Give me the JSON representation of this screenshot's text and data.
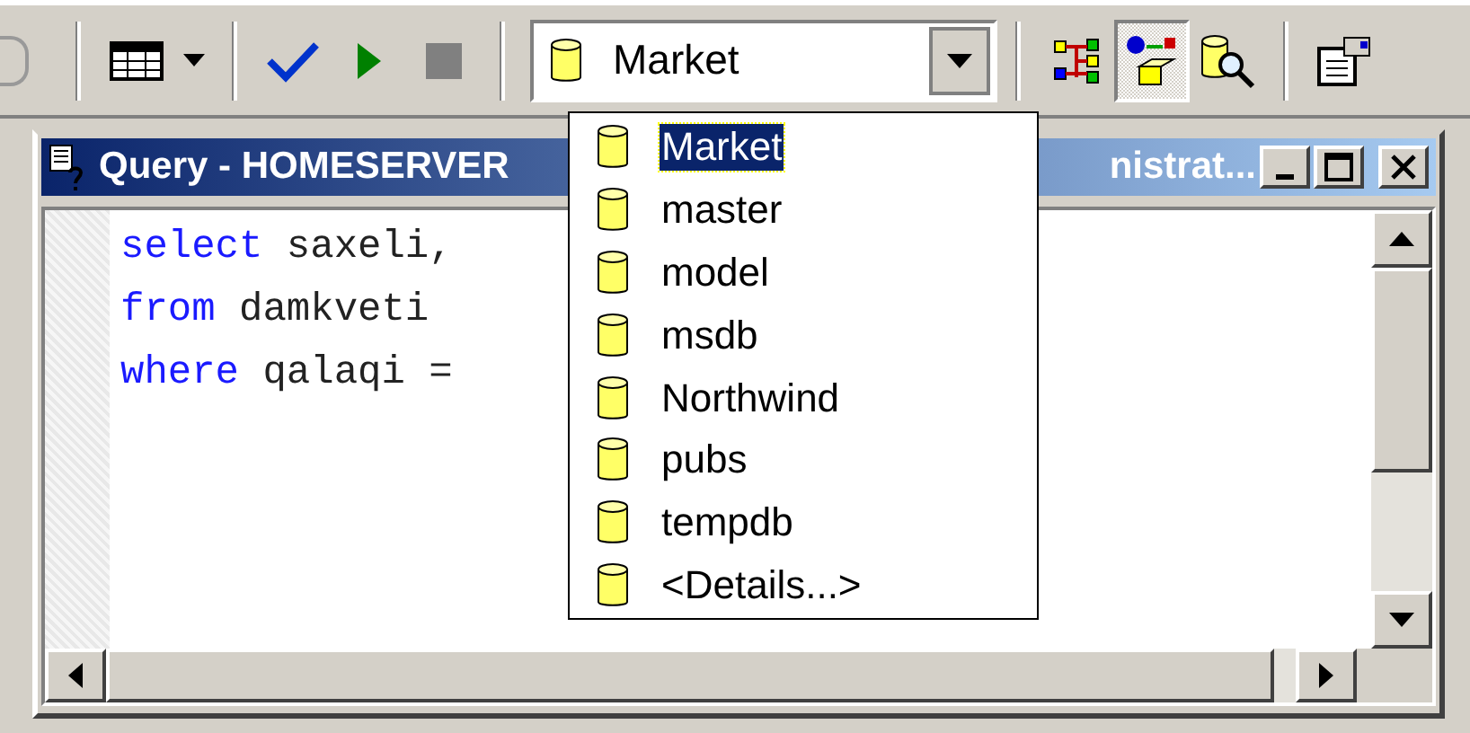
{
  "toolbar": {
    "buttons": [
      {
        "kind": "grid",
        "pressed": false
      },
      {
        "kind": "caret",
        "pressed": false
      },
      {
        "kind": "check",
        "pressed": false
      },
      {
        "kind": "play",
        "pressed": false
      },
      {
        "kind": "stop",
        "pressed": false
      },
      {
        "kind": "connections",
        "pressed": false
      },
      {
        "kind": "diagram",
        "pressed": true
      },
      {
        "kind": "db-search",
        "pressed": false
      },
      {
        "kind": "properties",
        "pressed": false
      }
    ],
    "database_combo": {
      "value": "Market",
      "expanded": true,
      "options": [
        {
          "label": "Market",
          "selected": true
        },
        {
          "label": "master",
          "selected": false
        },
        {
          "label": "model",
          "selected": false
        },
        {
          "label": "msdb",
          "selected": false
        },
        {
          "label": "Northwind",
          "selected": false
        },
        {
          "label": "pubs",
          "selected": false
        },
        {
          "label": "tempdb",
          "selected": false
        },
        {
          "label": "<Details...>",
          "selected": false
        }
      ]
    }
  },
  "query_window": {
    "title_start": "Query - HOMESERVER",
    "title_end": "nistrat...",
    "code_lines": [
      {
        "keyword": "select",
        "text": "saxeli,"
      },
      {
        "keyword": "from",
        "text": "damkveti"
      },
      {
        "keyword": "where",
        "text": "qalaqi ="
      }
    ]
  }
}
